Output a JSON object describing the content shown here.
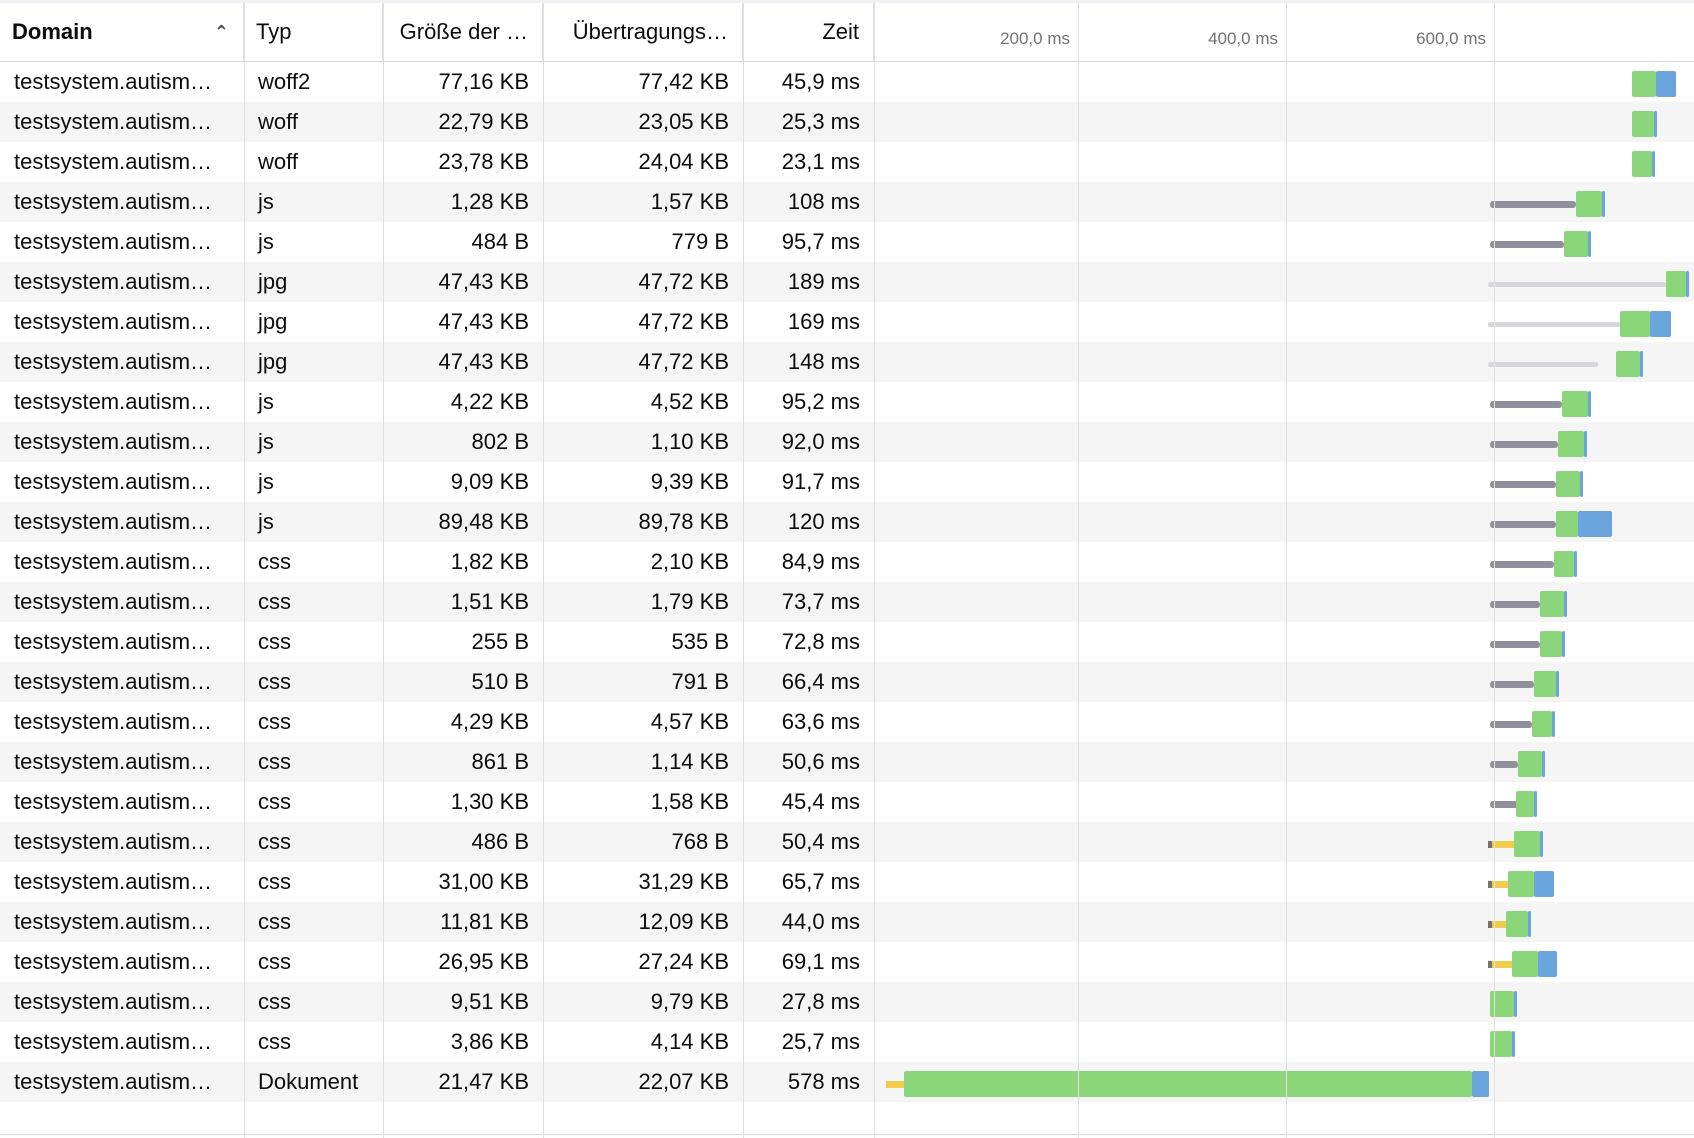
{
  "columns": {
    "domain": "Domain",
    "type": "Typ",
    "size": "Größe der …",
    "transferred": "Übertragungs…",
    "time": "Zeit"
  },
  "sort_icon": "chevron-up-icon",
  "waterfall": {
    "ticks": [
      "200,0 ms",
      "400,0 ms",
      "600,0 ms"
    ],
    "colors": {
      "queue": "#d7d7db",
      "blocked": "#737373",
      "dns": "#f2cc4d",
      "wait": "#8f8f9d",
      "receive": "#8bd67a",
      "transfer": "#6ba4dc"
    }
  },
  "rows": [
    {
      "domain": "testsystem.autism…",
      "type": "woff2",
      "size": "77,16 KB",
      "transferred": "77,42 KB",
      "time": "45,9 ms"
    },
    {
      "domain": "testsystem.autism…",
      "type": "woff",
      "size": "22,79 KB",
      "transferred": "23,05 KB",
      "time": "25,3 ms"
    },
    {
      "domain": "testsystem.autism…",
      "type": "woff",
      "size": "23,78 KB",
      "transferred": "24,04 KB",
      "time": "23,1 ms"
    },
    {
      "domain": "testsystem.autism…",
      "type": "js",
      "size": "1,28 KB",
      "transferred": "1,57 KB",
      "time": "108 ms"
    },
    {
      "domain": "testsystem.autism…",
      "type": "js",
      "size": "484 B",
      "transferred": "779 B",
      "time": "95,7 ms"
    },
    {
      "domain": "testsystem.autism…",
      "type": "jpg",
      "size": "47,43 KB",
      "transferred": "47,72 KB",
      "time": "189 ms"
    },
    {
      "domain": "testsystem.autism…",
      "type": "jpg",
      "size": "47,43 KB",
      "transferred": "47,72 KB",
      "time": "169 ms"
    },
    {
      "domain": "testsystem.autism…",
      "type": "jpg",
      "size": "47,43 KB",
      "transferred": "47,72 KB",
      "time": "148 ms"
    },
    {
      "domain": "testsystem.autism…",
      "type": "js",
      "size": "4,22 KB",
      "transferred": "4,52 KB",
      "time": "95,2 ms"
    },
    {
      "domain": "testsystem.autism…",
      "type": "js",
      "size": "802 B",
      "transferred": "1,10 KB",
      "time": "92,0 ms"
    },
    {
      "domain": "testsystem.autism…",
      "type": "js",
      "size": "9,09 KB",
      "transferred": "9,39 KB",
      "time": "91,7 ms"
    },
    {
      "domain": "testsystem.autism…",
      "type": "js",
      "size": "89,48 KB",
      "transferred": "89,78 KB",
      "time": "120 ms"
    },
    {
      "domain": "testsystem.autism…",
      "type": "css",
      "size": "1,82 KB",
      "transferred": "2,10 KB",
      "time": "84,9 ms"
    },
    {
      "domain": "testsystem.autism…",
      "type": "css",
      "size": "1,51 KB",
      "transferred": "1,79 KB",
      "time": "73,7 ms"
    },
    {
      "domain": "testsystem.autism…",
      "type": "css",
      "size": "255 B",
      "transferred": "535 B",
      "time": "72,8 ms"
    },
    {
      "domain": "testsystem.autism…",
      "type": "css",
      "size": "510 B",
      "transferred": "791 B",
      "time": "66,4 ms"
    },
    {
      "domain": "testsystem.autism…",
      "type": "css",
      "size": "4,29 KB",
      "transferred": "4,57 KB",
      "time": "63,6 ms"
    },
    {
      "domain": "testsystem.autism…",
      "type": "css",
      "size": "861 B",
      "transferred": "1,14 KB",
      "time": "50,6 ms"
    },
    {
      "domain": "testsystem.autism…",
      "type": "css",
      "size": "1,30 KB",
      "transferred": "1,58 KB",
      "time": "45,4 ms"
    },
    {
      "domain": "testsystem.autism…",
      "type": "css",
      "size": "486 B",
      "transferred": "768 B",
      "time": "50,4 ms"
    },
    {
      "domain": "testsystem.autism…",
      "type": "css",
      "size": "31,00 KB",
      "transferred": "31,29 KB",
      "time": "65,7 ms"
    },
    {
      "domain": "testsystem.autism…",
      "type": "css",
      "size": "11,81 KB",
      "transferred": "12,09 KB",
      "time": "44,0 ms"
    },
    {
      "domain": "testsystem.autism…",
      "type": "css",
      "size": "26,95 KB",
      "transferred": "27,24 KB",
      "time": "69,1 ms"
    },
    {
      "domain": "testsystem.autism…",
      "type": "css",
      "size": "9,51 KB",
      "transferred": "9,79 KB",
      "time": "27,8 ms"
    },
    {
      "domain": "testsystem.autism…",
      "type": "css",
      "size": "3,86 KB",
      "transferred": "4,14 KB",
      "time": "25,7 ms"
    },
    {
      "domain": "testsystem.autism…",
      "type": "Dokument",
      "size": "21,47 KB",
      "transferred": "22,07 KB",
      "time": "578 ms"
    }
  ]
}
